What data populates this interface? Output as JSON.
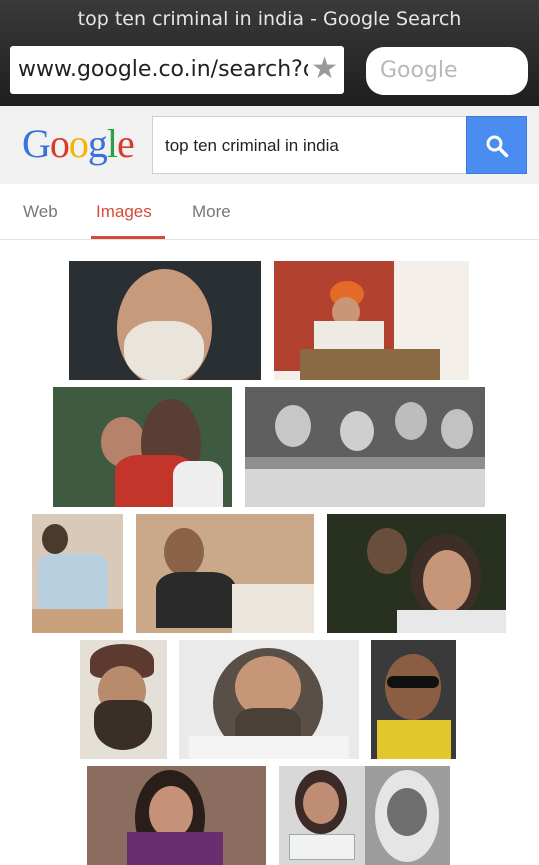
{
  "browser": {
    "title": "top ten criminal in india - Google Search",
    "url": "www.google.co.in/search?q=top+ten+criminal+in+india",
    "search_placeholder": "Google"
  },
  "google": {
    "logo_text": [
      "G",
      "o",
      "o",
      "g",
      "l",
      "e"
    ],
    "query": "top ten criminal in india"
  },
  "tabs": [
    {
      "label": "Web",
      "active": false
    },
    {
      "label": "Images",
      "active": true
    },
    {
      "label": "More",
      "active": false
    }
  ],
  "results": {
    "image_count": 14
  },
  "colors": {
    "accent_red": "#d84a38",
    "search_button": "#4a8cf0",
    "chrome_bg": "#2a2a2a"
  },
  "icons": {
    "bookmark": "star-icon",
    "search": "magnifier-icon"
  }
}
